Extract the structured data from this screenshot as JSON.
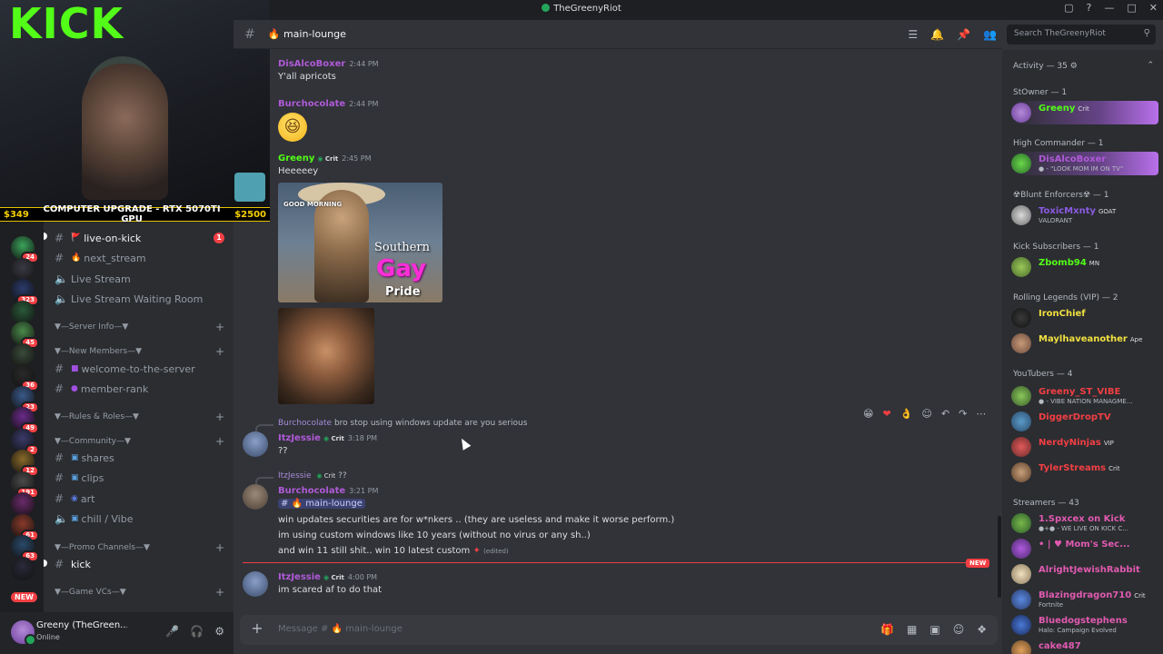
{
  "window": {
    "title": "TheGreenyRiot",
    "nav": "← →"
  },
  "stream": {
    "logo": "KICK",
    "ticker_left": "$349",
    "ticker_mid": "COMPUTER UPGRADE - RTX 5070TI GPU",
    "ticker_right": "$2500"
  },
  "rail": {
    "servers": [
      {
        "color": "#3aa35a",
        "badge": "24"
      },
      {
        "color": "#3a3a44",
        "badge": ""
      },
      {
        "color": "#2a3a6a",
        "badge": "323"
      },
      {
        "color": "#2a5a3a",
        "badge": ""
      },
      {
        "color": "#4a8a4a",
        "badge": "45"
      },
      {
        "color": "#3a4a3a",
        "badge": ""
      },
      {
        "color": "#2a2a2a",
        "badge": "36"
      },
      {
        "color": "#3a5a8a",
        "badge": "23"
      },
      {
        "color": "#6a2a8a",
        "badge": "49"
      },
      {
        "color": "#3a3a6a",
        "badge": "2"
      },
      {
        "color": "#8a6a2a",
        "badge": "12"
      },
      {
        "color": "#4a4a4a",
        "badge": "191"
      },
      {
        "color": "#6a2a6a",
        "badge": ""
      },
      {
        "color": "#8a3a2a",
        "badge": "61"
      },
      {
        "color": "#2a4a6a",
        "badge": "63"
      },
      {
        "color": "#2a2a3a",
        "badge": ""
      }
    ],
    "new_label": "NEW"
  },
  "channels": {
    "live": "live-on-kick",
    "live_badge": "1",
    "next": "next_stream",
    "voice1": "Live Stream",
    "voice2": "Live Stream Waiting Room",
    "cat_server_info": "▼—Server Info—▼",
    "cat_new_members": "▼—New Members—▼",
    "welcome": "welcome-to-the-server",
    "member_rank": "member-rank",
    "cat_rules": "▼—Rules & Roles—▼",
    "cat_community": "▼—Community—▼",
    "shares": "shares",
    "clips": "clips",
    "art": "art",
    "chill": "chill / Vibe",
    "cat_promo": "▼—Promo Channels—▼",
    "kick": "kick",
    "cat_game": "▼—Game VCs—▼"
  },
  "user": {
    "name": "Greeny (TheGreen...",
    "status": "Online"
  },
  "header": {
    "channel": "main-lounge",
    "search_placeholder": "Search TheGreenyRiot"
  },
  "messages": {
    "m1_author": "DisAlcoBoxer",
    "m1_time": "2:44 PM",
    "m1_text": "Y'all apricots",
    "m2_author": "Burchocolate",
    "m2_time": "2:44 PM",
    "m2_emoji": "😆",
    "m3_author": "Greeny",
    "m3_tag": "Crit",
    "m3_time": "2:45 PM",
    "m3_text": "Heeeeey",
    "gif1_gm": "GOOD MORNING",
    "gif1_t1": "Southern",
    "gif1_t2": "Gay",
    "gif1_t3": "Pride",
    "r1_user": "Burchocolate",
    "r1_text": "bro stop using windows update are you serious",
    "m4_author": "ItzJessie",
    "m4_tag": "Crit",
    "m4_time": "3:18 PM",
    "m4_text": "??",
    "r2_user": "ItzJessie",
    "r2_tag": "Crit",
    "r2_text": "??",
    "m5_author": "Burchocolate",
    "m5_time": "3:21 PM",
    "m5_mention": "main-lounge",
    "m5_l1": "win updates securities are for w*nkers .. (they are useless and make it worse perform.)",
    "m5_l2": "im using custom windows like 10 years (without no virus or any sh..)",
    "m5_l3": "and win 11 still shit.. win 10 latest custom",
    "m5_edited": "(edited)",
    "new_tag": "NEW",
    "m6_author": "ItzJessie",
    "m6_tag": "Crit",
    "m6_time": "4:00 PM",
    "m6_text": "im scared af to do that"
  },
  "composer": {
    "placeholder": "Message # 🔥 main-lounge"
  },
  "members": {
    "activity": "Activity — 35 ⚙",
    "r1": "StOwner — 1",
    "u1": "Greeny",
    "u1t": "Crit",
    "r2": "High Commander — 1",
    "u2": "DisAlcoBoxer",
    "u2s": "● - \"LOOK MOM IM ON TV\"",
    "r3": "☢Blunt Enforcers☢ — 1",
    "u3": "ToxicMxnty",
    "u3t": "GOAT",
    "u3s": "VALORANT",
    "r4": "Kick Subscribers — 1",
    "u4": "Zbomb94",
    "u4t": "MN",
    "r5": "Rolling Legends (VIP) — 2",
    "u5": "IronChief",
    "u6": "Maylhaveanother",
    "u6t": "Ape",
    "r6": "YouTubers — 4",
    "u7": "Greeny_ST_VIBE",
    "u7s": "● - VIBE NATION MANAGME...",
    "u8": "DiggerDropTV",
    "u9": "NerdyNinjas",
    "u9t": "VIP",
    "u10": "TylerStreams",
    "u10t": "Crit",
    "r7": "Streamers — 43",
    "u11": "1.Spxcex on Kick",
    "u11s": "●+● - WE LIVE ON KICK C...",
    "u12": "• | ♥ Mom's Sec...",
    "u13": "AlrightJewishRabbit",
    "u14": "Blazingdragon710",
    "u14t": "Crit",
    "u14s": "Fortnite",
    "u15": "Bluedogstephens",
    "u15s": "Halo: Campaign Evolved",
    "u16": "cake487"
  }
}
